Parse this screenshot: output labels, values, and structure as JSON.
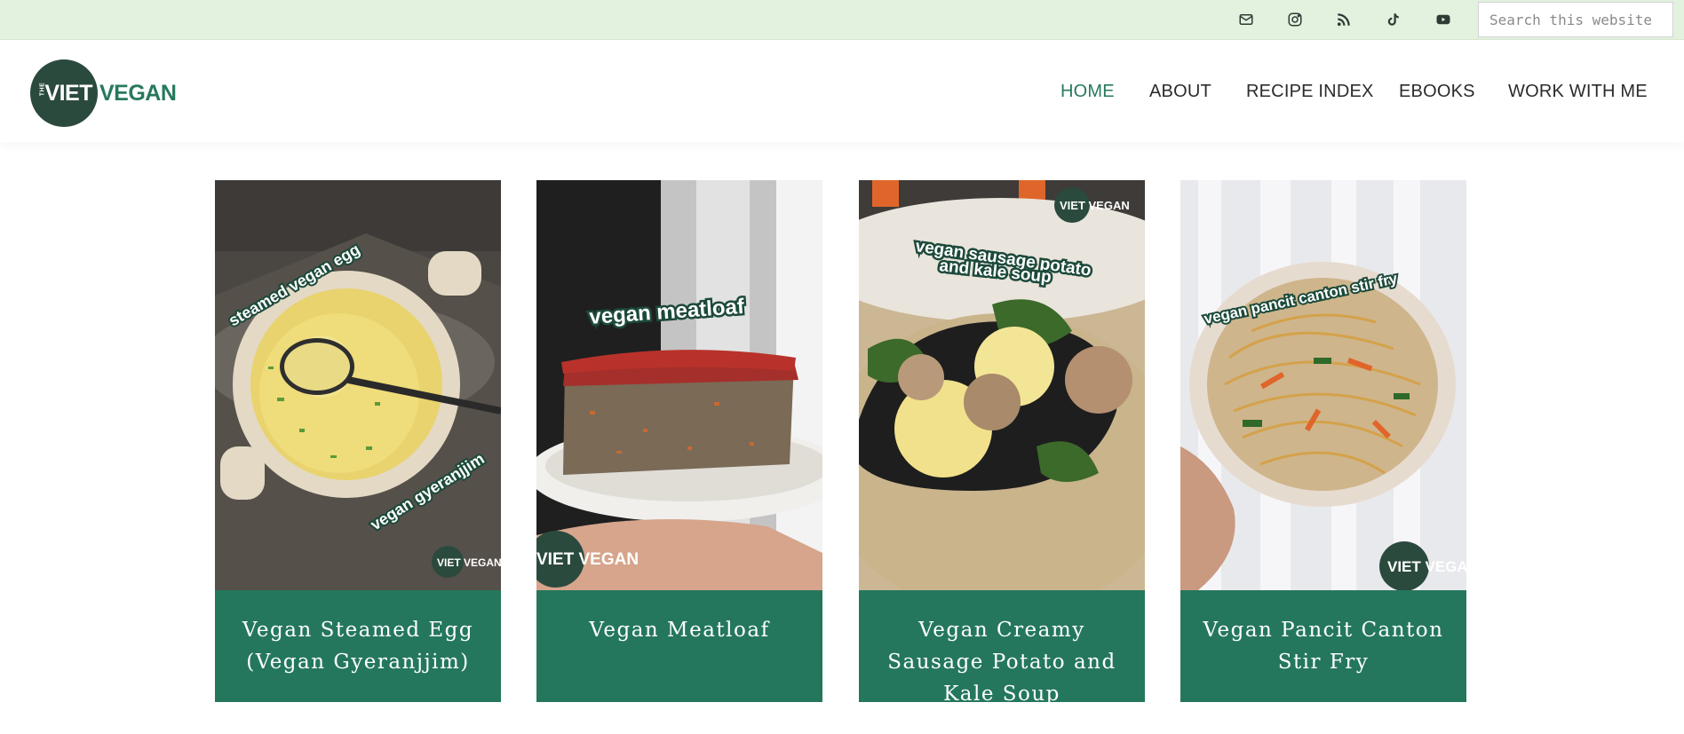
{
  "topbar": {
    "social_icons": [
      "email-icon",
      "instagram-icon",
      "rss-icon",
      "tiktok-icon",
      "youtube-icon"
    ],
    "search_placeholder": "Search this website"
  },
  "logo": {
    "the": "THE",
    "viet": "VIET",
    "vegan": "VEGAN"
  },
  "nav": [
    {
      "label": "HOME",
      "active": true
    },
    {
      "label": "ABOUT",
      "active": false
    },
    {
      "label": "RECIPE INDEX",
      "active": false
    },
    {
      "label": "EBOOKS",
      "active": false
    },
    {
      "label": "WORK WITH ME",
      "active": false
    }
  ],
  "cards": [
    {
      "title": "Vegan Steamed Egg (Vegan Gyeranjjim)",
      "overlay": [
        "steamed vegan egg",
        "vegan gyeranjjim"
      ],
      "watermark": "VIET VEGAN"
    },
    {
      "title": "Vegan Meatloaf",
      "overlay": [
        "vegan meatloaf"
      ],
      "watermark": "VIET VEGAN"
    },
    {
      "title": "Vegan Creamy Sausage Potato and Kale Soup",
      "overlay": [
        "vegan sausage potato",
        "and kale soup"
      ],
      "watermark": "VIET VEGAN"
    },
    {
      "title": "Vegan Pancit Canton Stir Fry",
      "overlay": [
        "vegan pancit canton stir fry"
      ],
      "watermark": "VIET VEGAN"
    }
  ],
  "colors": {
    "topbar_bg": "#e3f1df",
    "accent_green": "#24775d",
    "logo_dark": "#2b4a3e",
    "nav_text": "#2b2b2b"
  }
}
